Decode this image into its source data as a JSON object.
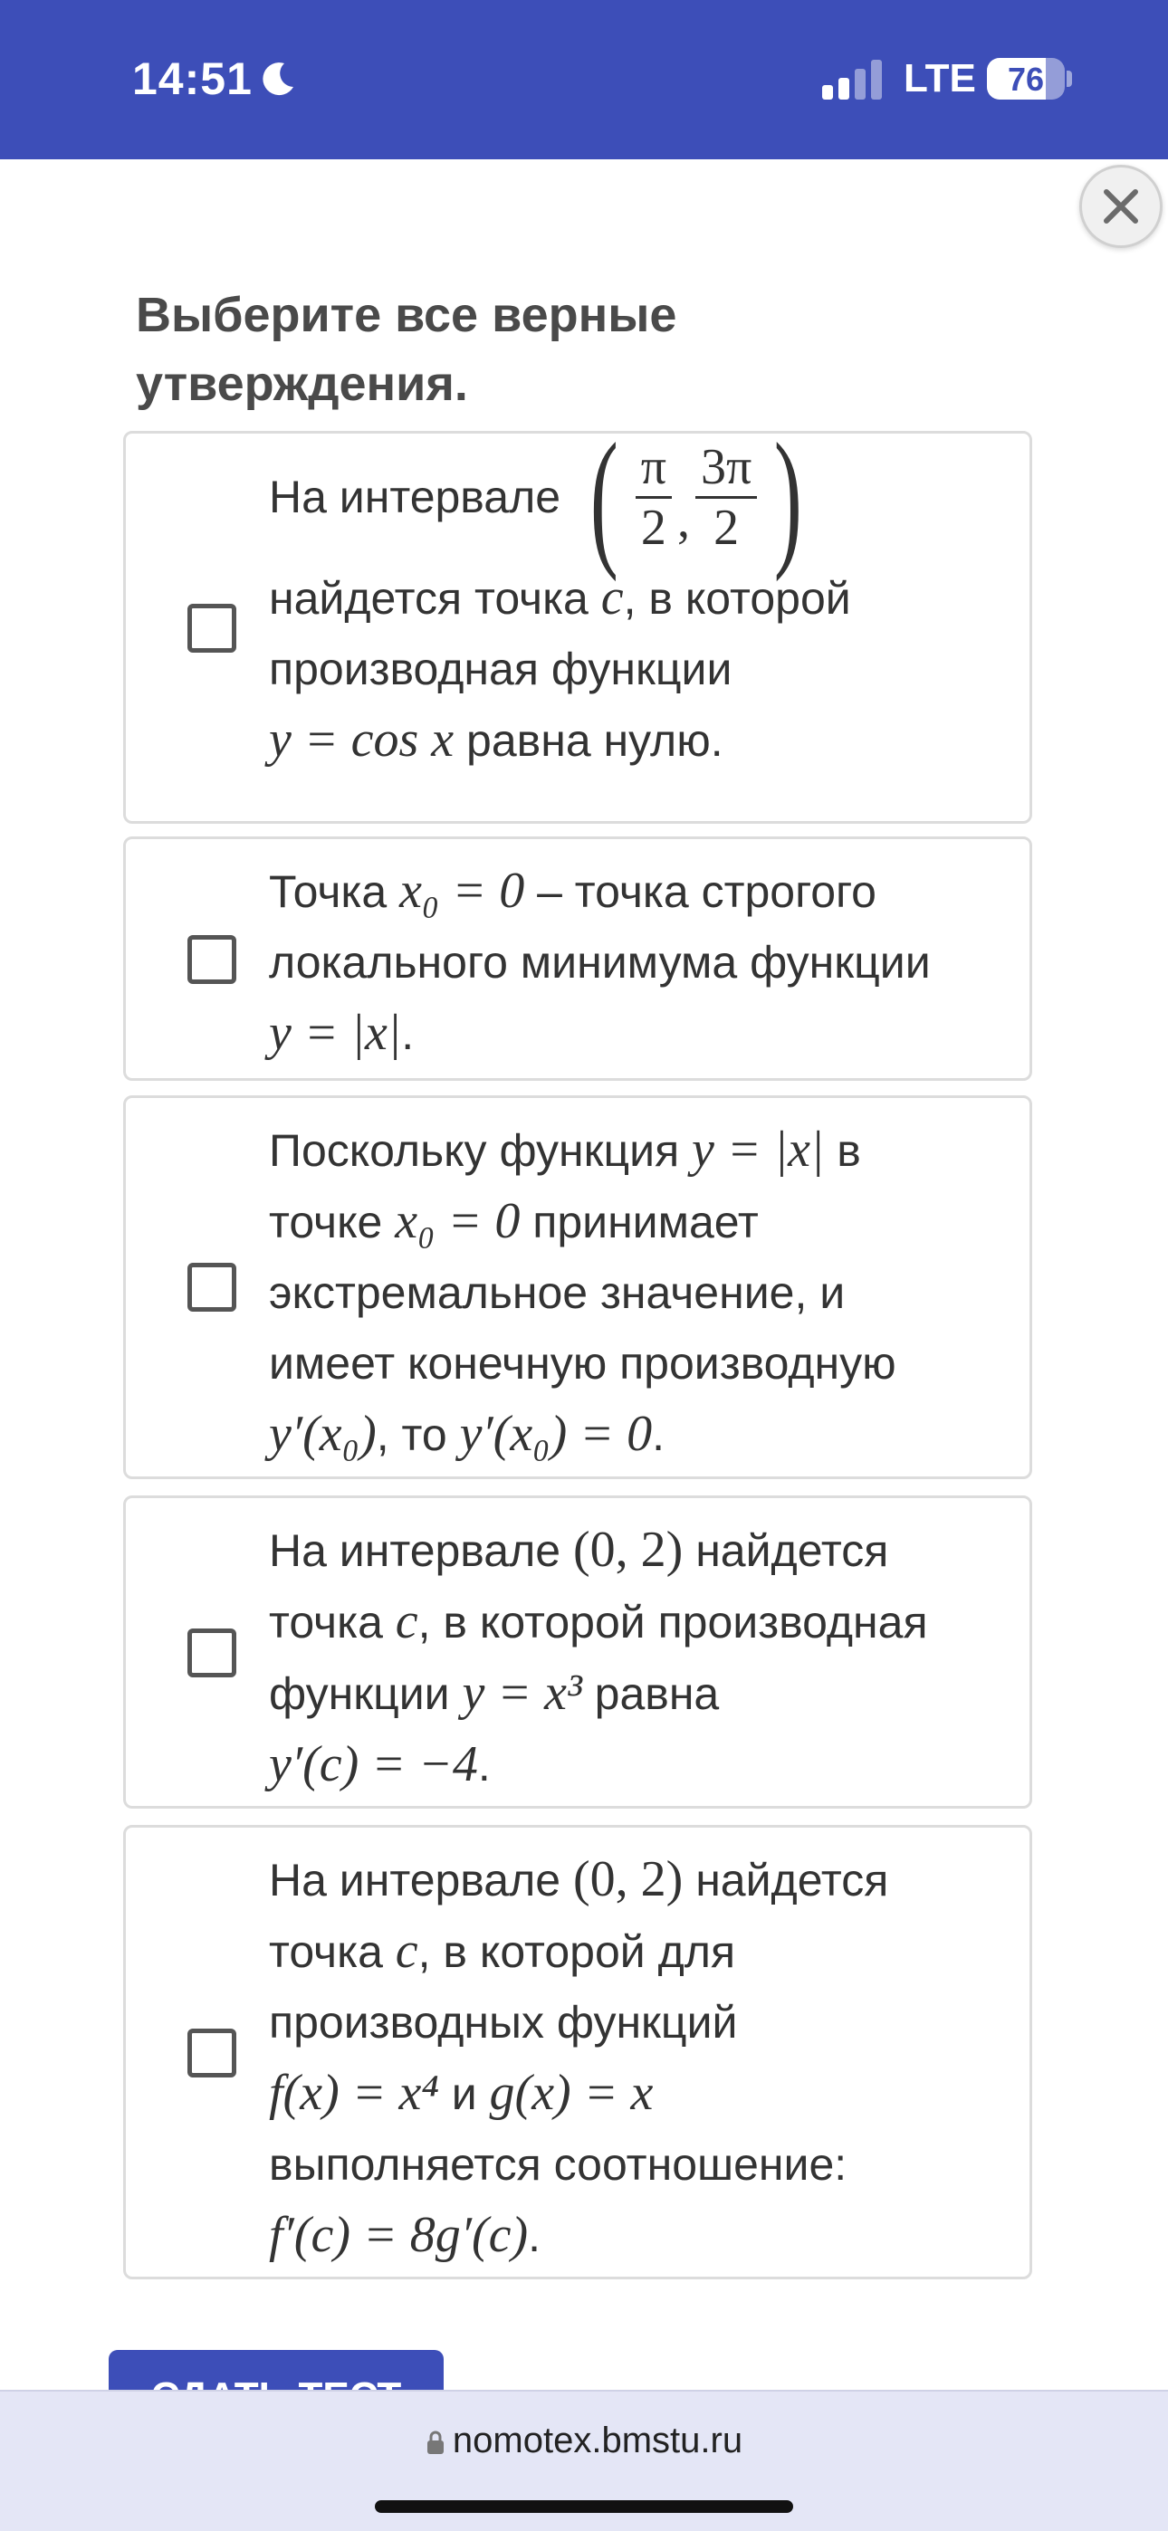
{
  "status_bar": {
    "time": "14:51",
    "network": "LTE",
    "battery": "76",
    "battery_level": 0.76
  },
  "question": {
    "title": "Выберите все верные утверждения."
  },
  "options": [
    {
      "text_before": "На интервале",
      "interval": {
        "a_num": "π",
        "a_den": "2",
        "b_num": "3π",
        "b_den": "2"
      },
      "line2a": "найдется точка ",
      "line2_var": "c",
      "line2b": ", в которой",
      "line3": "производная функции",
      "line4_math": "y = cos x",
      "line4_text": " равна нулю."
    },
    {
      "l1a": "Точка ",
      "l1_math": "x₀ = 0",
      "l1b": " – точка строгого",
      "l2": "локального минимума функции",
      "l3_math": "y = |x|",
      "l3b": "."
    },
    {
      "l1a": "Поскольку функция ",
      "l1_math": "y = |x|",
      "l1b": " в",
      "l2a": "точке ",
      "l2_math": "x₀ = 0",
      "l2b": " принимает",
      "l3": "экстремальное значение, и",
      "l4": "имеет конечную производную",
      "l5_math1": "y′(x₀)",
      "l5b": ", то ",
      "l5_math2": "y′(x₀) = 0",
      "l5c": "."
    },
    {
      "l1a": "На интервале ",
      "l1_math": "(0, 2)",
      "l1b": " найдется",
      "l2a": "точка ",
      "l2_math": "c",
      "l2b": ", в которой производная",
      "l3a": "функции ",
      "l3_math": "y = x³",
      "l3b": " равна",
      "l4_math": "y′(c) = −4",
      "l4b": "."
    },
    {
      "l1a": "На интервале ",
      "l1_math": "(0, 2)",
      "l1b": " найдется",
      "l2a": "точка ",
      "l2_math": "c",
      "l2b": ", в которой для",
      "l3": "производных функций",
      "l4_math1": "f(x) = x⁴",
      "l4b": " и ",
      "l4_math2": "g(x) = x",
      "l5": "выполняется соотношение:",
      "l6_math": "f′(c) = 8g′(c)",
      "l6b": "."
    }
  ],
  "submit": {
    "label": "СДАТЬ ТЕСТ"
  },
  "browser": {
    "url": "nomotex.bmstu.ru"
  }
}
